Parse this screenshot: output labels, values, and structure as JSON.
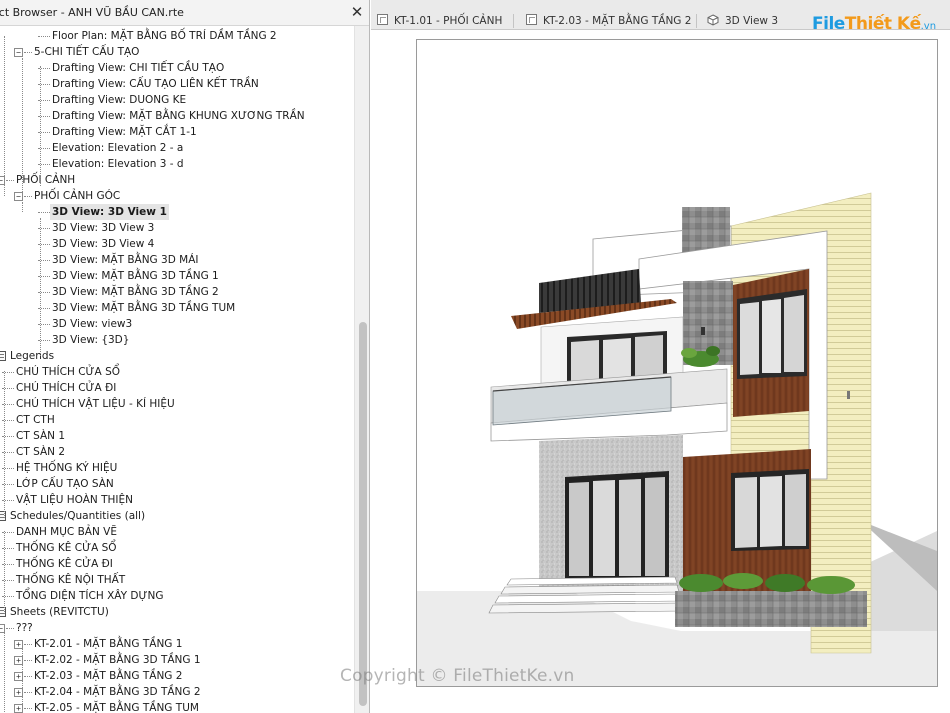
{
  "browser": {
    "title": "ect Browser - ANH VŨ BẦU CAN.rte",
    "close_glyph": "✕"
  },
  "tree": [
    {
      "label": "Floor Plan: MẶT BẰNG BỐ TRÍ DẦM TẦNG 2",
      "level": 3,
      "kind": "leaf"
    },
    {
      "label": "5-CHI TIẾT CẤU TẠO",
      "level": 2,
      "kind": "folder"
    },
    {
      "label": "Drafting View: CHI TIẾT CẦU TẠO",
      "level": 3,
      "kind": "leaf"
    },
    {
      "label": "Drafting View: CẤU TẠO LIÊN KẾT TRẦN",
      "level": 3,
      "kind": "leaf"
    },
    {
      "label": "Drafting View: DUONG KE",
      "level": 3,
      "kind": "leaf"
    },
    {
      "label": "Drafting View: MẶT BẰNG KHUNG XƯƠNG TRẦN",
      "level": 3,
      "kind": "leaf"
    },
    {
      "label": "Drafting View: MẶT CẮT 1-1",
      "level": 3,
      "kind": "leaf"
    },
    {
      "label": "Elevation: Elevation 2 - a",
      "level": 3,
      "kind": "leaf"
    },
    {
      "label": "Elevation: Elevation 3 - d",
      "level": 3,
      "kind": "leaf"
    },
    {
      "label": "PHỐI CẢNH",
      "level": 1,
      "kind": "folder"
    },
    {
      "label": "PHỐI CẢNH GÓC",
      "level": 2,
      "kind": "folder"
    },
    {
      "label": "3D View: 3D View 1",
      "level": 3,
      "kind": "leaf",
      "selected": true
    },
    {
      "label": "3D View: 3D View 3",
      "level": 3,
      "kind": "leaf"
    },
    {
      "label": "3D View: 3D View 4",
      "level": 3,
      "kind": "leaf"
    },
    {
      "label": "3D View: MẶT BẰNG 3D MÁI",
      "level": 3,
      "kind": "leaf"
    },
    {
      "label": "3D View: MẶT BẰNG 3D TẦNG 1",
      "level": 3,
      "kind": "leaf"
    },
    {
      "label": "3D View: MẶT BẰNG 3D TẦNG 2",
      "level": 3,
      "kind": "leaf"
    },
    {
      "label": "3D View: MẶT BẰNG 3D TẦNG TUM",
      "level": 3,
      "kind": "leaf"
    },
    {
      "label": "3D View: view3",
      "level": 3,
      "kind": "leaf"
    },
    {
      "label": "3D View: {3D}",
      "level": 3,
      "kind": "leaf"
    },
    {
      "label": "Legends",
      "level": 0,
      "kind": "category"
    },
    {
      "label": "CHÚ THÍCH CỬA SỔ",
      "level": 1,
      "kind": "leaf"
    },
    {
      "label": "CHÚ THÍCH CỬA ĐI",
      "level": 1,
      "kind": "leaf"
    },
    {
      "label": "CHÚ THÍCH VẬT LIỆU - KÍ HIỆU",
      "level": 1,
      "kind": "leaf"
    },
    {
      "label": "CT CTH",
      "level": 1,
      "kind": "leaf"
    },
    {
      "label": "CT SÀN 1",
      "level": 1,
      "kind": "leaf"
    },
    {
      "label": "CT SÀN 2",
      "level": 1,
      "kind": "leaf"
    },
    {
      "label": "HỆ THỐNG KÝ HIỆU",
      "level": 1,
      "kind": "leaf"
    },
    {
      "label": "LỚP CẤU TẠO SÀN",
      "level": 1,
      "kind": "leaf"
    },
    {
      "label": "VẬT LIỆU HOÀN THIỆN",
      "level": 1,
      "kind": "leaf"
    },
    {
      "label": "Schedules/Quantities (all)",
      "level": 0,
      "kind": "category"
    },
    {
      "label": "DANH MỤC BẢN VẼ",
      "level": 1,
      "kind": "leaf"
    },
    {
      "label": "THỐNG KÊ CỬA SỔ",
      "level": 1,
      "kind": "leaf"
    },
    {
      "label": "THỐNG KÊ CỬA ĐI",
      "level": 1,
      "kind": "leaf"
    },
    {
      "label": "THỐNG KÊ NỘI THẤT",
      "level": 1,
      "kind": "leaf"
    },
    {
      "label": "TỔNG DIỆN TÍCH XÂY DỰNG",
      "level": 1,
      "kind": "leaf"
    },
    {
      "label": "Sheets (REVITCTU)",
      "level": 0,
      "kind": "category"
    },
    {
      "label": "???",
      "level": 1,
      "kind": "folder"
    },
    {
      "label": "KT-2.01 - MẶT  BẰNG TẦNG 1",
      "level": 2,
      "kind": "sheet"
    },
    {
      "label": "KT-2.02 - MẶT BẰNG 3D TẦNG 1",
      "level": 2,
      "kind": "sheet"
    },
    {
      "label": "KT-2.03 - MẶT BẰNG TẦNG 2",
      "level": 2,
      "kind": "sheet"
    },
    {
      "label": "KT-2.04 - MẶT BẰNG 3D TẦNG 2",
      "level": 2,
      "kind": "sheet"
    },
    {
      "label": "KT-2.05 - MẶT BẰNG TẦNG TUM",
      "level": 2,
      "kind": "sheet"
    }
  ],
  "tabs": [
    {
      "label": "KT-1.01 - PHỐI CẢNH",
      "icon": "sheet-icon"
    },
    {
      "label": "KT-2.03 - MẶT BẰNG TẦNG 2",
      "icon": "sheet-icon"
    },
    {
      "label": "3D View 3",
      "icon": "cube-icon"
    }
  ],
  "logo": {
    "part1": "File",
    "part2": "Thiết Kế",
    "part3": ".vn"
  },
  "watermark": "Copyright © FileThietKe.vn",
  "colors": {
    "selected_row": "#e4e4e4",
    "wood": "#7a3f22",
    "siding": "#f3eec0",
    "logo_blue": "#1e9be0",
    "logo_orange": "#f39a1b"
  }
}
